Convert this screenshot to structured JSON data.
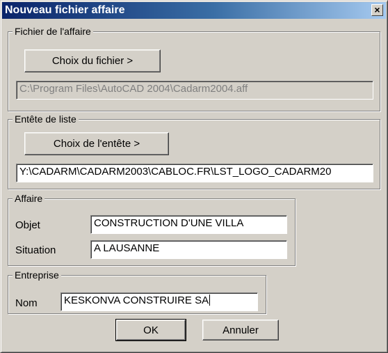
{
  "window": {
    "title": "Nouveau fichier affaire",
    "close_glyph": "×"
  },
  "fichier_affaire": {
    "legend": "Fichier de l'affaire",
    "button_label": "Choix du fichier >",
    "path_value": "C:\\Program Files\\AutoCAD 2004\\Cadarm2004.aff"
  },
  "entete_liste": {
    "legend": "Entête de liste",
    "button_label": "Choix de l'entête >",
    "path_value": "Y:\\CADARM\\CADARM2003\\CABLOC.FR\\LST_LOGO_CADARM20"
  },
  "affaire": {
    "legend": "Affaire",
    "objet_label": "Objet",
    "objet_value": "CONSTRUCTION D'UNE VILLA",
    "situation_label": "Situation",
    "situation_value": "A LAUSANNE"
  },
  "entreprise": {
    "legend": "Entreprise",
    "nom_label": "Nom",
    "nom_value": "KESKONVA CONSTRUIRE SA"
  },
  "actions": {
    "ok_label": "OK",
    "cancel_label": "Annuler"
  },
  "colors": {
    "dialog_face": "#d4d0c8",
    "titlebar_start": "#0a246a",
    "titlebar_end": "#a6caf0",
    "field_background": "#ffffff",
    "disabled_text": "#808080"
  }
}
